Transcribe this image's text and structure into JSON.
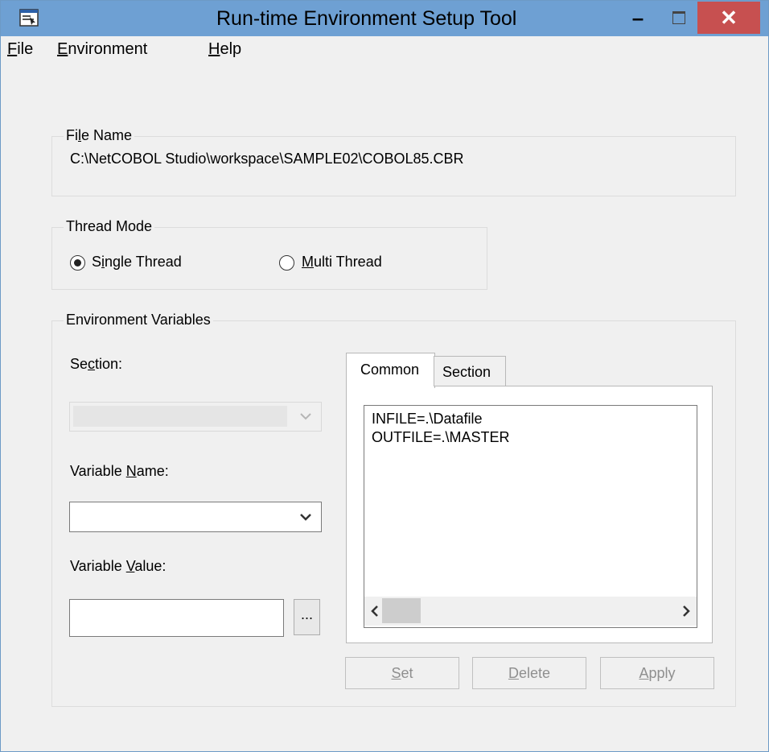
{
  "window": {
    "title": "Run-time Environment Setup Tool",
    "minimize": "–",
    "close": "✕"
  },
  "menu": [
    {
      "pre": "",
      "key": "F",
      "post": "ile"
    },
    {
      "pre": "",
      "key": "E",
      "post": "nvironment"
    },
    {
      "pre": "",
      "key": "H",
      "post": "elp"
    }
  ],
  "file_name": {
    "legend": {
      "pre": "Fi",
      "key": "l",
      "post": "e Name"
    },
    "value": "C:\\NetCOBOL Studio\\workspace\\SAMPLE02\\COBOL85.CBR"
  },
  "thread_mode": {
    "legend": "Thread Mode",
    "single": {
      "pre": "S",
      "key": "i",
      "post": "ngle Thread",
      "selected": true
    },
    "multi": {
      "pre": "",
      "key": "M",
      "post": "ulti Thread",
      "selected": false
    }
  },
  "env_vars": {
    "legend": "Environment Variables",
    "section_label": {
      "pre": "Se",
      "key": "c",
      "post": "tion:"
    },
    "var_name_label": {
      "pre": "Variable ",
      "key": "N",
      "post": "ame:"
    },
    "var_value_label": {
      "pre": "Variable ",
      "key": "V",
      "post": "alue:"
    },
    "var_name_value": "",
    "var_value_value": "",
    "browse_label": "...",
    "tabs": [
      "Common",
      "Section"
    ],
    "active_tab": "Common",
    "lines": [
      "INFILE=.\\Datafile",
      "OUTFILE=.\\MASTER"
    ],
    "buttons": {
      "set": {
        "pre": "",
        "key": "S",
        "post": "et"
      },
      "delete": {
        "pre": "",
        "key": "D",
        "post": "elete"
      },
      "apply": {
        "pre": "",
        "key": "A",
        "post": "pply"
      }
    }
  },
  "colors": {
    "titlebar": "#6ea0d3",
    "close": "#c75050",
    "face": "#f0f0f0"
  }
}
